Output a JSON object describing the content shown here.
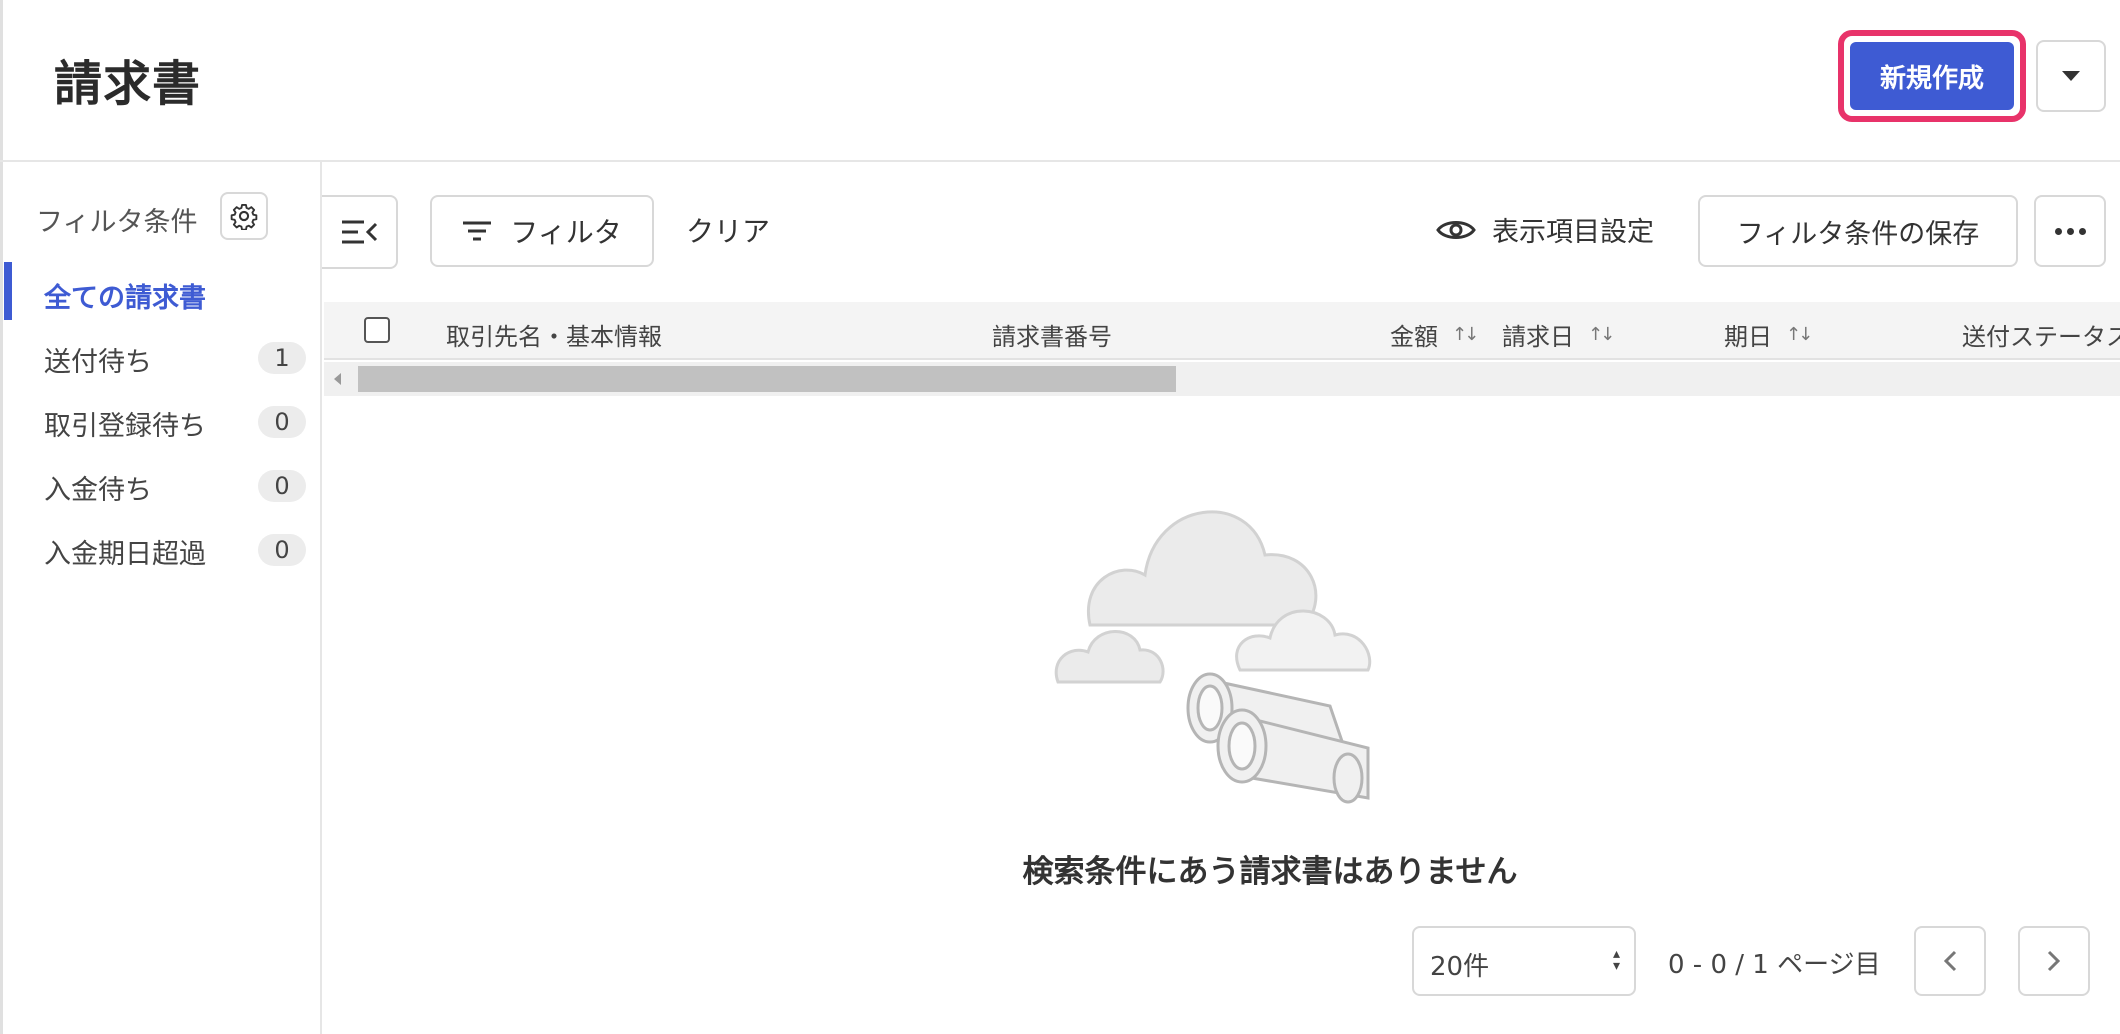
{
  "header": {
    "title": "請求書",
    "new_button": "新規作成"
  },
  "sidebar": {
    "title": "フィルタ条件",
    "items": [
      {
        "label": "全ての請求書",
        "count": ""
      },
      {
        "label": "送付待ち",
        "count": "1"
      },
      {
        "label": "取引登録待ち",
        "count": "0"
      },
      {
        "label": "入金待ち",
        "count": "0"
      },
      {
        "label": "入金期日超過",
        "count": "0"
      }
    ]
  },
  "toolbar": {
    "filter_label": "フィルタ",
    "clear_label": "クリア",
    "view_settings_label": "表示項目設定",
    "save_filter_label": "フィルタ条件の保存"
  },
  "table": {
    "columns": [
      "取引先名・基本情報",
      "請求書番号",
      "金額",
      "請求日",
      "期日",
      "送付ステータス"
    ]
  },
  "empty_state": {
    "message": "検索条件にあう請求書はありません"
  },
  "pagination": {
    "page_size": "20件",
    "info": "0 - 0 / 1 ページ目"
  },
  "colors": {
    "primary": "#3e5bd3",
    "highlight": "#e8336a"
  }
}
